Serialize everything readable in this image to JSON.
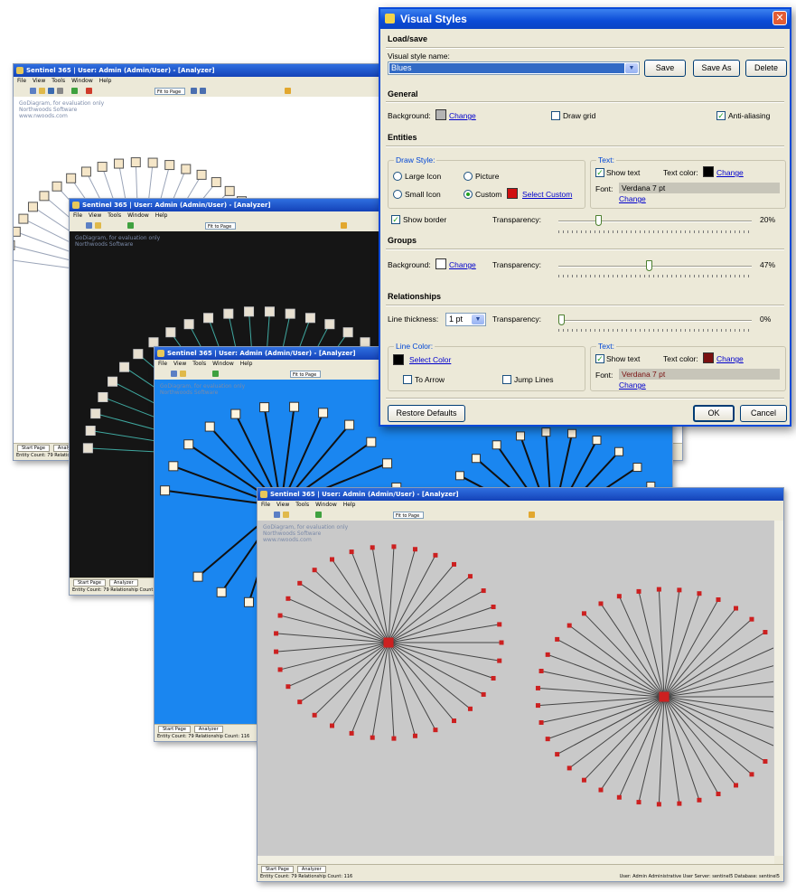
{
  "windows": {
    "w1": {
      "title": "Sentinel 365 | User: Admin (Admin/User) - [Analyzer]",
      "menu": [
        "File",
        "View",
        "Tools",
        "Window",
        "Help"
      ],
      "zoom": "Fit to Page",
      "watermark": [
        "GoDiagram, for evaluation only",
        "Northwoods Software",
        "www.nwoods.com"
      ],
      "tabs": [
        "Start Page",
        "Analyzer"
      ],
      "status": "Entity Count: 79 Relationship Count: 116",
      "bg": "#ffffff"
    },
    "w2": {
      "title": "Sentinel 365 | User: Admin (Admin/User) - [Analyzer]",
      "menu": [
        "File",
        "View",
        "Tools",
        "Window",
        "Help"
      ],
      "zoom": "Fit to Page",
      "watermark": [
        "GoDiagram, for evaluation only",
        "Northwoods Software"
      ],
      "tabs": [
        "Start Page",
        "Analyzer"
      ],
      "status": "Entity Count: 79 Relationship Count: 116",
      "bg": "#151515"
    },
    "w3": {
      "title": "Sentinel 365 | User: Admin (Admin/User) - [Analyzer]",
      "menu": [
        "File",
        "View",
        "Tools",
        "Window",
        "Help"
      ],
      "zoom": "Fit to Page",
      "watermark": [
        "GoDiagram, for evaluation only",
        "Northwoods Software"
      ],
      "tabs": [
        "Start Page",
        "Analyzer"
      ],
      "status": "Entity Count: 79 Relationship Count: 116",
      "bg": "#1a86f0"
    },
    "w4": {
      "title": "Sentinel 365 | User: Admin (Admin/User) - [Analyzer]",
      "menu": [
        "File",
        "View",
        "Tools",
        "Window",
        "Help"
      ],
      "zoom": "Fit to Page",
      "watermark": [
        "GoDiagram, for evaluation only",
        "Northwoods Software",
        "www.nwoods.com"
      ],
      "tabs": [
        "Start Page",
        "Analyzer"
      ],
      "status": "Entity Count: 79 Relationship Count: 116",
      "status_right": "User: Admin   Administrative User   Server: sentinel5   Database: sentinel5",
      "bg": "#c9c9c9"
    }
  },
  "dialog": {
    "title": "Visual Styles",
    "load_save": {
      "heading": "Load/save",
      "name_label": "Visual style name:",
      "name_value": "Blues",
      "save": "Save",
      "save_as": "Save As",
      "delete": "Delete"
    },
    "general": {
      "heading": "General",
      "background_label": "Background:",
      "background_color": "#b4b4b4",
      "change": "Change",
      "draw_grid": "Draw grid",
      "draw_grid_checked": false,
      "anti_aliasing": "Anti-aliasing",
      "anti_aliasing_checked": true
    },
    "entities": {
      "heading": "Entities",
      "draw_style": {
        "title": "Draw Style:",
        "large_icon": "Large Icon",
        "picture": "Picture",
        "small_icon": "Small Icon",
        "custom": "Custom",
        "selected": "Custom",
        "custom_color": "#d01010",
        "select_custom": "Select Custom"
      },
      "text": {
        "title": "Text:",
        "show_text": "Show text",
        "show_text_checked": true,
        "text_color_label": "Text color:",
        "text_color": "#000000",
        "change": "Change",
        "font_label": "Font:",
        "font_value": "Verdana 7 pt",
        "font_change": "Change"
      },
      "show_border": "Show border",
      "show_border_checked": true,
      "transparency_label": "Transparency:",
      "transparency": 20,
      "transparency_text": "20%"
    },
    "groups": {
      "heading": "Groups",
      "background_label": "Background:",
      "background_color": "#ffffff",
      "change": "Change",
      "transparency_label": "Transparency:",
      "transparency": 47,
      "transparency_text": "47%"
    },
    "relationships": {
      "heading": "Relationships",
      "line_thickness_label": "Line thickness:",
      "line_thickness": "1 pt",
      "transparency_label": "Transparency:",
      "transparency": 0,
      "transparency_text": "0%",
      "line_color": {
        "title": "Line Color:",
        "color": "#000000",
        "select_color": "Select Color",
        "to_arrow": "To Arrow",
        "to_arrow_checked": false,
        "jump_lines": "Jump Lines",
        "jump_lines_checked": false
      },
      "text": {
        "title": "Text:",
        "show_text": "Show text",
        "show_text_checked": true,
        "text_color_label": "Text color:",
        "text_color": "#7a1010",
        "change": "Change",
        "font_label": "Font:",
        "font_value": "Verdana 7 pt",
        "font_change": "Change"
      }
    },
    "restore_defaults": "Restore Defaults",
    "ok": "OK",
    "cancel": "Cancel"
  }
}
